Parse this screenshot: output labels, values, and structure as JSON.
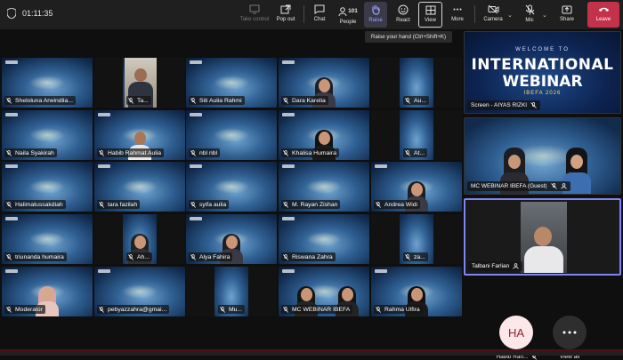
{
  "toolbar": {
    "timer": "01:11:35",
    "buttons": {
      "take_control": "Take control",
      "pop_out": "Pop out",
      "chat": "Chat",
      "people": "People",
      "people_count": "101",
      "raise": "Raise",
      "react": "React",
      "view": "View",
      "more": "More",
      "camera": "Camera",
      "mic": "Mic",
      "share": "Share",
      "leave": "Leave"
    },
    "tooltip": "Raise your hand (Ctrl+Shift+K)"
  },
  "tiles": [
    {
      "name": "Sheloluna Arwindila..."
    },
    {
      "name": "Ta..."
    },
    {
      "name": "Siti Aulia Rahmi"
    },
    {
      "name": "Dara Karelia"
    },
    {
      "name": "Au..."
    },
    {
      "name": "Naila Syakirah"
    },
    {
      "name": "Habib Rahmat Aulia"
    },
    {
      "name": "nbl nbl"
    },
    {
      "name": "Khalisa Humaira"
    },
    {
      "name": "At..."
    },
    {
      "name": "Halimatussakdiah"
    },
    {
      "name": "tara fazilah"
    },
    {
      "name": "syifa aulia"
    },
    {
      "name": "M. Rayan Zishan"
    },
    {
      "name": "Andrea Widi"
    },
    {
      "name": "triunanda humaira"
    },
    {
      "name": "Ah..."
    },
    {
      "name": "Alya Fahira"
    },
    {
      "name": "Riswana Zahra"
    },
    {
      "name": "za..."
    },
    {
      "name": "Moderator"
    },
    {
      "name": "pebyazzahra@gmai..."
    },
    {
      "name": "Mu..."
    },
    {
      "name": "MC WEBINAR IBEFA"
    },
    {
      "name": "Rahma Ulfira"
    }
  ],
  "side": {
    "banner": {
      "line1": "WELCOME TO",
      "line2": "INTERNATIONAL",
      "line3": "WEBINAR",
      "line4": "IBEFA 2026",
      "caption": "Screen - AIYAS RIZKI"
    },
    "mc_caption": "MC WEBINAR IBEFA (Guest)",
    "talbani_caption": "Talbani Farlian",
    "avatar_initials": "HA",
    "avatar_caption": "Habib Rah...",
    "view_all": "View all"
  },
  "colors": {
    "accent": "#7f85f5",
    "leave": "#c4314b",
    "avatar_bg": "#fde7e9",
    "avatar_fg": "#8a2532"
  }
}
